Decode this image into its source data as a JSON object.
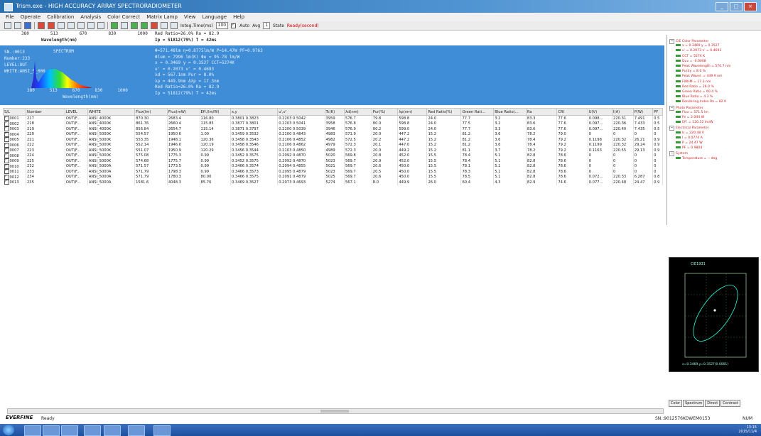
{
  "window": {
    "title": "Trism.exe - HIGH ACCURACY ARRAY SPECTRORADIOMETER"
  },
  "menu": [
    "File",
    "Operate",
    "Calibration",
    "Analysis",
    "Color Correct",
    "Matrix Lamp",
    "View",
    "Language",
    "Help"
  ],
  "toolbar": {
    "integ_label": "Integ.Time(ms)",
    "integ_value": "100",
    "auto_label": "Auto",
    "avg_label": "Avg",
    "avg_value": "1",
    "state_label": "State",
    "state_value": "Ready(second)"
  },
  "upper_strip": {
    "ticks": [
      "380",
      "513",
      "670",
      "830",
      "1000"
    ],
    "axis_label": "Wavelength(nm)",
    "top_text": "Red Ratio=26.0%   Ra = 82.9",
    "tp_text": "Ip = 51812(79%)   T = 42ms"
  },
  "measure_panel": {
    "left_lines": [
      "SN.:0013",
      "Number:233",
      "LEVEL:OUT",
      "WHITE:ANSI_5_000"
    ],
    "spectrum_title": "SPECTRUM",
    "right_lines": [
      "Φ=571.48lm  η=0.8775lm/W  P=14.47W  PF=0.9763",
      "Φlum = 7996  lm(K)  Φe = 95.78 lm/W",
      "x = 0.3469   y = 0.3527  CCT=5274K",
      "u' = 0.2073   v' = 0.4693",
      "λd = 567.1nm   Pur = 8.0%",
      "λp = 449.9nm  Δλp = 17.3nm",
      "Red Ratio=26.0%  Ra = 82.9",
      "Ip = 51812(79%)   T = 42ms"
    ],
    "ticks": [
      "380",
      "513",
      "670",
      "830",
      "1000"
    ],
    "axis_label": "Wavelength(nm)"
  },
  "table": {
    "columns": [
      "S/L",
      "Number",
      "LEVEL",
      "WHITE",
      "Flux(lm)",
      "Flux(mW)",
      "Eff.(lm/W)",
      "x,y",
      "u',v'",
      "Tc(K)",
      "λd(nm)",
      "Pur(%)",
      "λp(nm)",
      "Red Ratio(%)",
      "Green Rati...",
      "Blue Ratio(...",
      "Ra",
      "CRI",
      "U(V)",
      "I(A)",
      "P(W)",
      "PF"
    ],
    "rows": [
      [
        "0001",
        "217",
        "OUT(F...",
        "ANSI_4000K",
        "870.30",
        "2683.4",
        "116.80",
        "0.3801 0.3823",
        "0.2203 0.5042",
        "3959",
        "576.7",
        "79.8",
        "598.8",
        "24.0",
        "77.7",
        "3.2",
        "83.3",
        "77.6",
        "0.098...",
        "220.31",
        "7.491",
        "0.5"
      ],
      [
        "0002",
        "218",
        "OUT(F...",
        "ANSI_4000K",
        "861.76",
        "2660.4",
        "115.85",
        "0.3877 0.3801",
        "0.2203 0.5041",
        "3958",
        "576.8",
        "80.0",
        "598.8",
        "24.0",
        "77.5",
        "3.2",
        "83.6",
        "77.6",
        "0.097...",
        "220.36",
        "7.433",
        "0.5"
      ],
      [
        "0003",
        "219",
        "OUT(F...",
        "ANSI_4000K",
        "856.84",
        "2654.7",
        "115.14",
        "0.3871 0.3797",
        "0.2200 0.5039",
        "3946",
        "576.9",
        "80.2",
        "599.0",
        "24.0",
        "77.7",
        "3.3",
        "83.6",
        "77.6",
        "0.097...",
        "220.40",
        "7.435",
        "0.5"
      ],
      [
        "0004",
        "220",
        "OUT(F...",
        "ANSI_5000K",
        "554.57",
        "1950.6",
        "1.00",
        "0.3459 0.3532",
        "0.2100 0.4843",
        "4983",
        "571.9",
        "20.0",
        "447.2",
        "15.2",
        "81.2",
        "3.6",
        "78.2",
        "79.0",
        "0",
        "0",
        "0",
        "0"
      ],
      [
        "0005",
        "221",
        "OUT(F...",
        "ANSI_5000K",
        "553.35",
        "1948.1",
        "120.36",
        "0.3458 0.3543",
        "0.2106 0.4852",
        "4982",
        "572.5",
        "20.2",
        "447.2",
        "15.2",
        "81.2",
        "3.6",
        "78.4",
        "79.2",
        "0.1198",
        "220.32",
        "26.21",
        "0.9"
      ],
      [
        "0006",
        "222",
        "OUT(F...",
        "ANSI_5000K",
        "552.14",
        "1946.0",
        "120.19",
        "0.3458 0.3546",
        "0.2106 0.4862",
        "4979",
        "572.3",
        "20.1",
        "447.0",
        "15.2",
        "81.2",
        "3.6",
        "78.4",
        "79.2",
        "0.1199",
        "220.32",
        "29.24",
        "0.9"
      ],
      [
        "0007",
        "223",
        "OUT(F...",
        "ANSI_5000K",
        "551.07",
        "1950.9",
        "120.29",
        "0.3456 0.3544",
        "0.2103 0.4850",
        "4989",
        "572.3",
        "20.0",
        "449.2",
        "15.2",
        "81.1",
        "3.7",
        "78.2",
        "79.2",
        "0.1163",
        "220.55",
        "29.13",
        "0.9"
      ],
      [
        "0008",
        "224",
        "OUT(F...",
        "ANSI_5000K",
        "575.08",
        "1775.3",
        "0.99",
        "0.3452 0.3575",
        "0.2092 0.4870",
        "5020",
        "569.8",
        "20.8",
        "452.0",
        "15.5",
        "78.4",
        "5.1",
        "82.8",
        "78.6",
        "0",
        "0",
        "0",
        "0"
      ],
      [
        "0009",
        "225",
        "OUT(F...",
        "ANSI_5000K",
        "574.68",
        "1775.7",
        "0.99",
        "0.3452 0.3575",
        "0.2092 0.4870",
        "5023",
        "569.7",
        "20.9",
        "452.0",
        "15.5",
        "78.4",
        "5.1",
        "82.8",
        "78.6",
        "0",
        "0",
        "0",
        "0"
      ],
      [
        "0010",
        "232",
        "OUT(F...",
        "ANSI_5000A",
        "571.57",
        "1773.5",
        "0.99",
        "0.3466 0.3574",
        "0.2094 0.4855",
        "5021",
        "569.7",
        "20.6",
        "450.0",
        "15.5",
        "78.1",
        "5.1",
        "82.8",
        "78.6",
        "0",
        "0",
        "0",
        "0"
      ],
      [
        "0011",
        "233",
        "OUT(F...",
        "ANSI_5000A",
        "571.79",
        "1798.3",
        "0.99",
        "0.3466 0.3573",
        "0.2095 0.4879",
        "5023",
        "569.7",
        "20.5",
        "450.0",
        "15.5",
        "78.3",
        "5.1",
        "82.8",
        "78.6",
        "0",
        "0",
        "0",
        "0"
      ],
      [
        "0012",
        "234",
        "OUT(F...",
        "ANSI_5000A",
        "571.79",
        "1780.3",
        "80.00",
        "0.3466 0.3575",
        "0.2091 0.4879",
        "5025",
        "569.7",
        "20.6",
        "450.0",
        "15.5",
        "78.5",
        "5.1",
        "82.8",
        "78.6",
        "0.072...",
        "220.33",
        "6.287",
        "0.8"
      ],
      [
        "0013",
        "235",
        "OUT(F...",
        "ANSI_5000A",
        "1581.6",
        "4048.3",
        "85.76",
        "0.3469 0.3527",
        "0.2073 0.4693",
        "5274",
        "567.1",
        "8.0",
        "449.9",
        "26.0",
        "60.4",
        "4.3",
        "82.9",
        "74.6",
        "0.077...",
        "220.48",
        "24.47",
        "0.9"
      ]
    ]
  },
  "parameter_tree": {
    "groups": [
      {
        "label": "CIE Color Parameter",
        "items": [
          "x = 0.3469 y = 0.3527",
          "u' = 0.2073 v' = 0.4693",
          "CCT = 5274 K",
          "Duv = -0.0008",
          "Peak Wavelength = 570.7 nm",
          "Purity = 8.0 %",
          "Peak Wavel. = 449.9 nm",
          "FWHM = 17.3 nm",
          "Red Ratio = 26.0 %",
          "Green Ratio = 60.4 %",
          "Blue Ratio = 4.3 %",
          "Rendering Index Ra = 82.9"
        ]
      },
      {
        "label": "Photo Parameter",
        "items": [
          "Flux = 571.5 lm",
          "Fe = 2.044 W",
          "Eff. = 120.32 lm/W"
        ]
      },
      {
        "label": "Electrical Parameter",
        "items": [
          "U = 220.48 V",
          "I = 0.0774 A",
          "P = 24.47 W",
          "PF = 0.9804"
        ]
      },
      {
        "label": "System",
        "items": [
          "Temperature = -- deg"
        ]
      }
    ]
  },
  "cie_panel": {
    "title": "CIE1931",
    "bottom_text": "x=0.3469,y=0.3527(0.0001)"
  },
  "tabs": [
    "Color",
    "Spectrum",
    "Direct",
    "Contrast"
  ],
  "status": {
    "logo": "EVERFINE",
    "ready": "Ready",
    "sn": "SN.:9012576KOWEM0153",
    "num": "NUM"
  },
  "taskbar": {
    "time": "13:15",
    "date": "2015/11/4"
  },
  "colors": {
    "panel_blue": "#3f8dd6",
    "title_blue": "#2a6fb0",
    "tree_text": "#cc2222"
  }
}
